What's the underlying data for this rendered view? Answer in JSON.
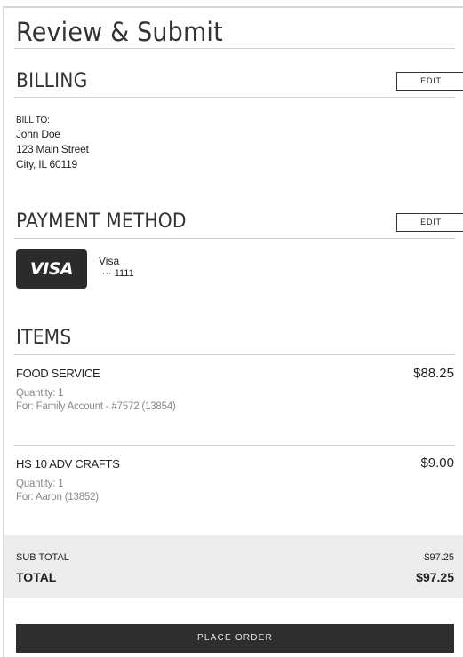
{
  "page": {
    "title": "Review & Submit"
  },
  "billing": {
    "section_title": "BILLING",
    "edit_label": "EDIT",
    "bill_to_label": "BILL TO:",
    "name": "John Doe",
    "street": "123 Main Street",
    "city_line": "City, IL 60119"
  },
  "payment": {
    "section_title": "PAYMENT METHOD",
    "edit_label": "EDIT",
    "card_logo_text": "VISA",
    "card_brand": "Visa",
    "card_number": "···· 1111"
  },
  "items": {
    "section_title": "ITEMS",
    "list": [
      {
        "name": "FOOD SERVICE",
        "price": "$88.25",
        "quantity": "Quantity: 1",
        "for": "For: Family Account - #7572 (13854)"
      },
      {
        "name": "HS 10 ADV CRAFTS",
        "price": "$9.00",
        "quantity": "Quantity: 1",
        "for": "For: Aaron (13852)"
      }
    ]
  },
  "totals": {
    "subtotal_label": "SUB TOTAL",
    "subtotal_value": "$97.25",
    "total_label": "TOTAL",
    "total_value": "$97.25"
  },
  "actions": {
    "place_order_label": "PLACE ORDER"
  },
  "colors": {
    "dark": "#2e2e2e",
    "totals_bg": "#ececec",
    "muted_text": "#888888"
  }
}
